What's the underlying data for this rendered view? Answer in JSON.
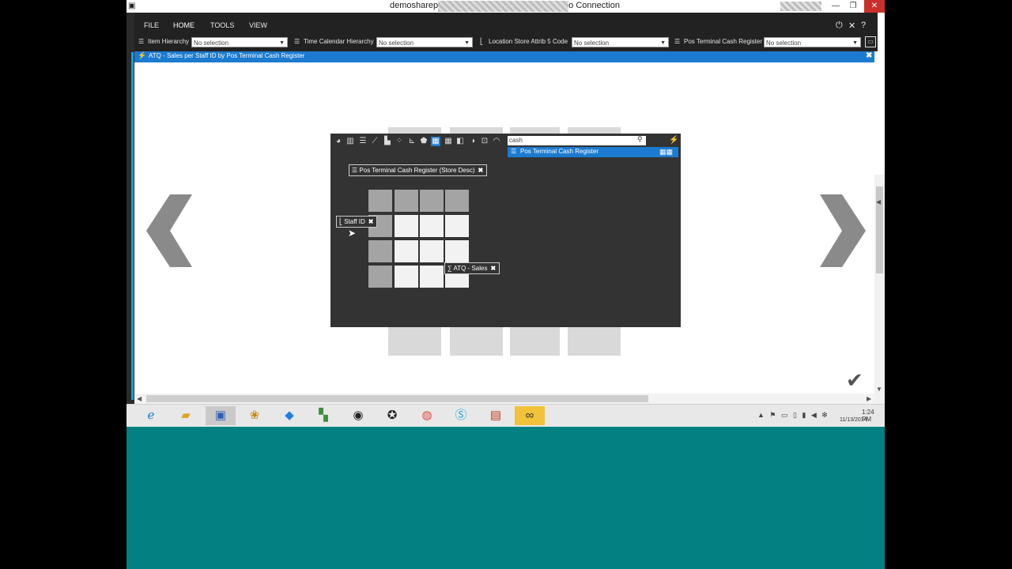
{
  "window": {
    "title_prefix": "demosharep",
    "title_suffix": "o Connection",
    "minimize": "—",
    "restore": "❐",
    "close": "✕"
  },
  "menu": {
    "items": [
      "FILE",
      "HOME",
      "TOOLS",
      "VIEW"
    ],
    "power_icon": "⏻",
    "settings_icon": "✕",
    "help_icon": "?"
  },
  "filters": [
    {
      "label": "Item Hierarchy",
      "value": "No selection"
    },
    {
      "label": "Time Calendar Hierarchy",
      "value": "No selection"
    },
    {
      "label": "Location Store Attrib 5 Code",
      "value": "No selection"
    },
    {
      "label": "Pos Terminal Cash Register",
      "value": "No selection"
    }
  ],
  "view_tab": {
    "title": "ATQ - Sales per Staff ID by Pos Terminal Cash Register",
    "close": "✖"
  },
  "dialog": {
    "search_value": "cash",
    "search_result": "Pos Terminal Cash Register",
    "column_chip": "Pos Terminal Cash Register (Store Desc)",
    "row_chip": "Staff ID",
    "measure_chip": "ATQ - Sales",
    "chip_close": "✖",
    "toolbar_icons": [
      "pie-chart",
      "column-chart",
      "bar-chart",
      "line-chart",
      "area-chart",
      "scatter-chart",
      "combo-chart",
      "map-chart",
      "grid",
      "table",
      "treemap",
      "bubble",
      "network",
      "gauge"
    ],
    "selected_tool": "grid"
  },
  "nav": {
    "prev": "❮",
    "next": "❯",
    "confirm": "✔"
  },
  "taskbar": {
    "apps": [
      "internet-explorer",
      "file-explorer",
      "remote-desktop",
      "app-flower",
      "dropbox",
      "app-green",
      "app-ring",
      "app-tool",
      "chrome",
      "skype",
      "powerpoint",
      "app-infinity"
    ],
    "active_apps": [
      "remote-desktop",
      "app-infinity"
    ],
    "time": "1:24 PM",
    "date": "11/13/2014"
  },
  "colors": {
    "accent": "#1c7bd0",
    "desktop": "#028082",
    "dark": "#333333"
  }
}
